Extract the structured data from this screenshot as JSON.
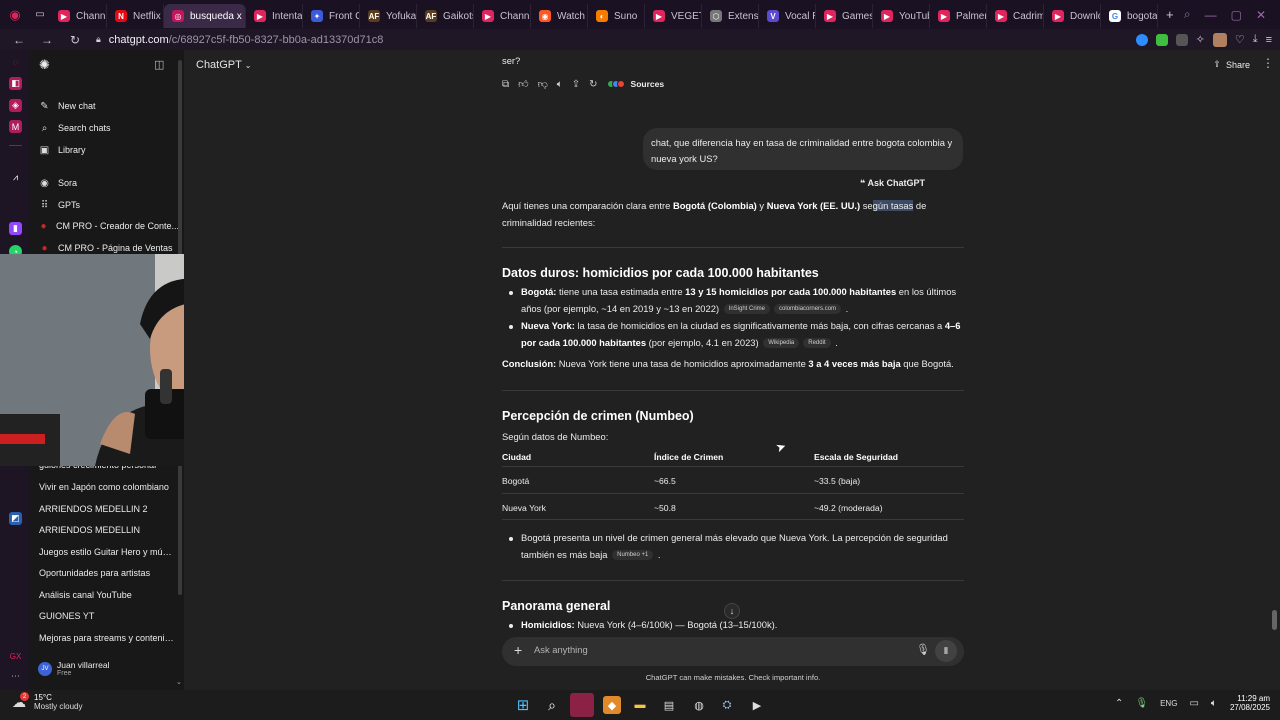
{
  "browser": {
    "tabs": [
      {
        "label": "Channe",
        "color": "#e0245e",
        "glyph": "▶"
      },
      {
        "label": "Netflix",
        "color": "#e50914",
        "glyph": "N"
      },
      {
        "label": "busqueda x",
        "color": "#c2185b",
        "glyph": "◎",
        "active": true
      },
      {
        "label": "Intenta",
        "color": "#e0245e",
        "glyph": "▶"
      },
      {
        "label": "Front C",
        "color": "#3b5bdb",
        "glyph": "✦"
      },
      {
        "label": "Yofuka",
        "color": "#5a3d1e",
        "glyph": "AF"
      },
      {
        "label": "Gaikots",
        "color": "#5a3d1e",
        "glyph": "AF"
      },
      {
        "label": "Channe",
        "color": "#e0245e",
        "glyph": "▶"
      },
      {
        "label": "Watch",
        "color": "#ff5722",
        "glyph": "◉"
      },
      {
        "label": "Suno",
        "color": "#f57c00",
        "glyph": "◐"
      },
      {
        "label": "VEGET",
        "color": "#e0245e",
        "glyph": "▶"
      },
      {
        "label": "Extens",
        "color": "#777777",
        "glyph": "⬡"
      },
      {
        "label": "Vocal R",
        "color": "#5c4bd1",
        "glyph": "V"
      },
      {
        "label": "Games",
        "color": "#e0245e",
        "glyph": "▶"
      },
      {
        "label": "YouTub",
        "color": "#e0245e",
        "glyph": "▶"
      },
      {
        "label": "Palmer",
        "color": "#e0245e",
        "glyph": "▶"
      },
      {
        "label": "Cadrim",
        "color": "#e0245e",
        "glyph": "▶"
      },
      {
        "label": "Downlo",
        "color": "#e0245e",
        "glyph": "▶"
      },
      {
        "label": "bogota",
        "color": "#ffffff",
        "glyph": "G"
      }
    ],
    "new_tab": "+",
    "url_host": "chatgpt.com",
    "url_path": "/c/68927c5f-fb50-8327-bb0a-ad13370d71c8"
  },
  "sidebar": {
    "top_items": [
      {
        "label": "New chat",
        "icon": "✎"
      },
      {
        "label": "Search chats",
        "icon": "⌕"
      },
      {
        "label": "Library",
        "icon": "▣"
      },
      {
        "label": "Sora",
        "icon": "◉"
      },
      {
        "label": "GPTs",
        "icon": "⠿"
      },
      {
        "label": "CM PRO - Creador de Conte...",
        "icon": "●"
      },
      {
        "label": "CM PRO - Página de Ventas",
        "icon": "●"
      }
    ],
    "chats": [
      "guiones crecimiento personal",
      "Vivir en Japón como colombiano",
      "ARRIENDOS MEDELLIN 2",
      "ARRIENDOS MEDELLIN",
      "Juegos estilo Guitar Hero y músi...",
      "Oportunidades para artistas",
      "Análisis canal YouTube",
      "GUIONES YT",
      "Mejoras para streams y contenido"
    ],
    "user": {
      "initials": "JV",
      "name": "Juan villarreal",
      "plan": "Free"
    }
  },
  "header": {
    "model": "ChatGPT",
    "share": "Share"
  },
  "conversation": {
    "prev_tail": "ser?",
    "sources": "Sources",
    "user_message": "chat, que diferencia hay en tasa de criminalidad entre bogota colombia y nueva york US?",
    "ask_chatgpt": "Ask ChatGPT",
    "intro_a": "Aquí tienes una comparación clara entre ",
    "intro_b": "Bogotá (Colombia)",
    "intro_c": " y ",
    "intro_d": "Nueva York (EE. UU.)",
    "intro_e": " se",
    "intro_f": "gún tasas",
    "intro_g": " de",
    "intro_line2": "criminalidad recientes:",
    "section1_title": "Datos duros: homicidios por cada 100.000 habitantes",
    "b1_label": "Bogotá:",
    "b1_text": " tiene una tasa estimada entre ",
    "b1_bold": "13 y 15 homicidios por cada 100.000 habitantes",
    "b1_tail": " en los últimos",
    "b1_line2": "años (por ejemplo, ~14 en 2019 y ~13 en 2022)",
    "b1_chip1": "InSight Crime",
    "b1_chip2": "colombiacorners.com",
    "b2_label": "Nueva York:",
    "b2_text": " la tasa de homicidios en la ciudad es significativamente más baja, con cifras cercanas a ",
    "b2_bold": "4–6",
    "b2_line2_bold": "por cada 100.000 habitantes",
    "b2_line2": " (por ejemplo, 4.1 en 2023)",
    "b2_chip1": "Wikipedia",
    "b2_chip2": "Reddit",
    "concl_label": "Conclusión:",
    "concl_text": " Nueva York tiene una tasa de homicidios aproximadamente ",
    "concl_bold": "3 a 4 veces más baja",
    "concl_tail": " que Bogotá.",
    "section2_title": "Percepción de crimen (Numbeo)",
    "numbeo_intro": "Según datos de Numbeo:",
    "table": {
      "headers": [
        "Ciudad",
        "Índice de Crimen",
        "Escala de Seguridad"
      ],
      "rows": [
        [
          "Bogotá",
          "~66.5",
          "~33.5 (baja)"
        ],
        [
          "Nueva York",
          "~50.8",
          "~49.2 (moderada)"
        ]
      ]
    },
    "b3_text": "Bogotá presenta un nivel de crimen general más elevado que Nueva York. La percepción de seguridad",
    "b3_line2": "también es más baja",
    "b3_chip": "Numbeo +1",
    "section3_title": "Panorama general",
    "b4_label": "Homicidios:",
    "b4_text": " Nueva York (4–6/100k) — Bogotá (13–15/100k)."
  },
  "composer": {
    "placeholder": "Ask anything",
    "disclaimer": "ChatGPT can make mistakes. Check important info."
  },
  "taskbar": {
    "weather_temp": "15°C",
    "weather_desc": "Mostly cloudy",
    "weather_badge": "2",
    "lang": "ENG",
    "time": "11:29 am",
    "date": "27/08/2025"
  },
  "colors": {
    "bg": "#212121",
    "sidebar": "#181818",
    "bubble": "#303030",
    "tabbar": "#1a1122"
  }
}
